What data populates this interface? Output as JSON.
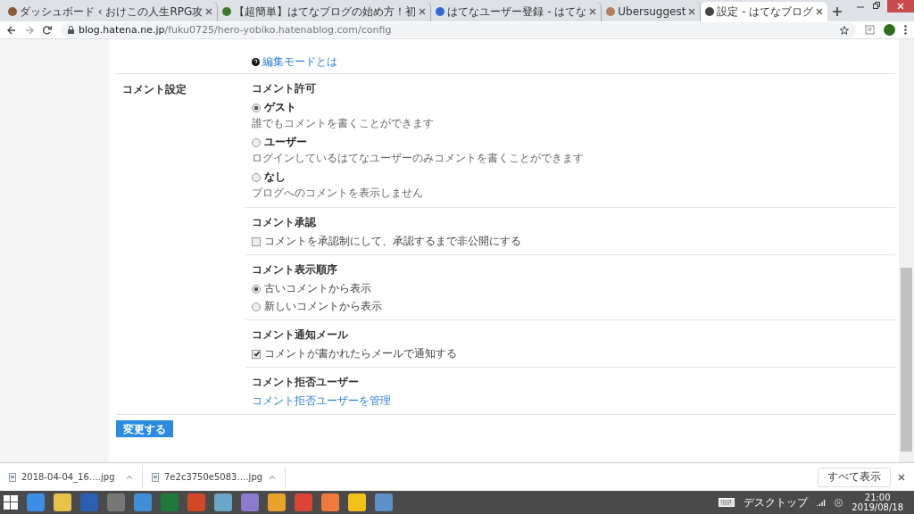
{
  "browser": {
    "tabs": [
      {
        "title": "ダッシュボード ‹ おけこの人生RPG攻",
        "selected": false
      },
      {
        "title": "【超簡単】はてなブログの始め方！初",
        "selected": false
      },
      {
        "title": "はてなユーザー登録 - はてな",
        "selected": false
      },
      {
        "title": "Ubersuggest",
        "selected": false
      },
      {
        "title": "設定 - はてなブログ",
        "selected": true
      }
    ],
    "url": {
      "host": "blog.hatena.ne.jp",
      "path": "/fuku0725/hero-yobiko.hatenablog.com/config"
    }
  },
  "page": {
    "help_link": "編集モードとは",
    "section_label": "コメント設定",
    "groups": [
      {
        "title": "コメント許可",
        "kind": "radio",
        "options": [
          {
            "label": "ゲスト",
            "description": "誰でもコメントを書くことができます",
            "selected": true
          },
          {
            "label": "ユーザー",
            "description": "ログインしているはてなユーザーのみコメントを書くことができます",
            "selected": false
          },
          {
            "label": "なし",
            "description": "ブログへのコメントを表示しません",
            "selected": false
          }
        ]
      },
      {
        "title": "コメント承認",
        "kind": "checkbox",
        "options": [
          {
            "label": "コメントを承認制にして、承認するまで非公開にする",
            "checked": false
          }
        ]
      },
      {
        "title": "コメント表示順序",
        "kind": "radio",
        "options": [
          {
            "label": "古いコメントから表示",
            "selected": true
          },
          {
            "label": "新しいコメントから表示",
            "selected": false
          }
        ]
      },
      {
        "title": "コメント通知メール",
        "kind": "checkbox",
        "options": [
          {
            "label": "コメントが書かれたらメールで通知する",
            "checked": true
          }
        ]
      },
      {
        "title": "コメント拒否ユーザー",
        "kind": "link",
        "link": "コメント拒否ユーザーを管理"
      }
    ],
    "submit_button": "変更する"
  },
  "downloads": {
    "files": [
      "2018-04-04_16….jpg",
      "7e2c3750e5083….jpg"
    ],
    "show_all": "すべて表示"
  },
  "taskbar": {
    "desktop_label": "デスクトップ",
    "time": "21:00",
    "date": "2019/08/18"
  }
}
